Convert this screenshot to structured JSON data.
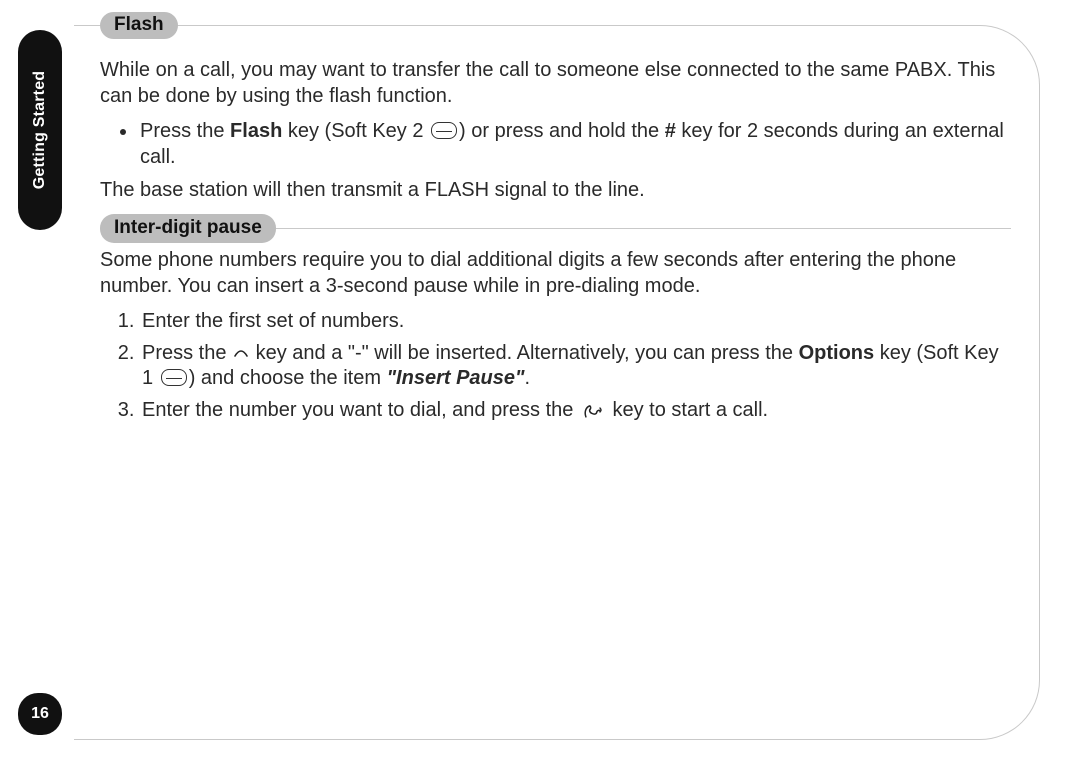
{
  "sideTab": {
    "label": "Getting Started"
  },
  "pageNumber": "16",
  "sections": {
    "flash": {
      "title": "Flash",
      "intro": "While on a call, you may want to transfer the call to someone else connected to the same PABX. This can be done by using the flash function.",
      "bullets": [
        {
          "pre": "Press the ",
          "boldKey": "Flash",
          "mid1": " key (Soft Key 2 ",
          "mid2": ") or press and hold the ",
          "boldHash": "#",
          "tail": " key for 2 seconds during an external call."
        }
      ],
      "outro": "The base station will then transmit a FLASH signal to the line."
    },
    "pause": {
      "title": "Inter-digit pause",
      "intro": "Some phone numbers require you to dial additional digits a few seconds after entering the phone number. You can insert a 3-second pause while in pre-dialing mode.",
      "steps": [
        {
          "text": "Enter the first set of numbers."
        },
        {
          "p1": "Press the ",
          "p2": " key and a \"-\" will be inserted. Alternatively, you can press the ",
          "bold": "Options",
          "p3": " key (Soft Key 1 ",
          "p4": ") and choose the item ",
          "ital": "\"Insert Pause\"",
          "p5": "."
        },
        {
          "p1": "Enter the number you want to dial, and press the ",
          "p2": " key to start a call."
        }
      ]
    }
  }
}
